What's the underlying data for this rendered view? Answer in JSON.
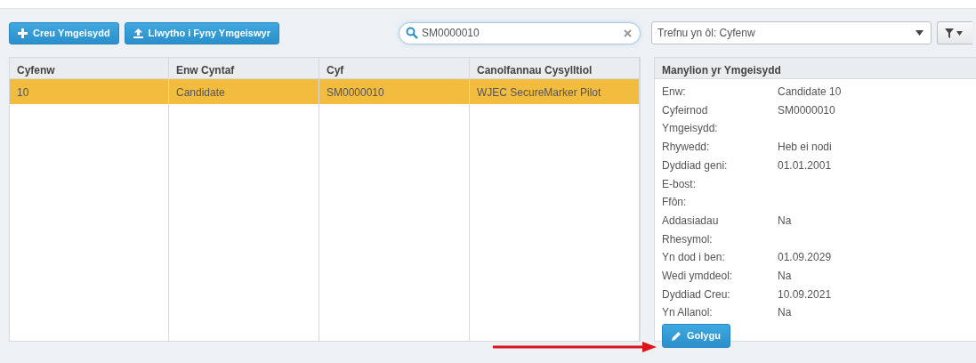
{
  "toolbar": {
    "buttons": [
      {
        "label": "Creu Ymgeisydd",
        "kind": "plus"
      },
      {
        "label": "Llwytho i Fyny Ymgeiswyr",
        "kind": "upload"
      }
    ]
  },
  "search": {
    "value": "SM0000010"
  },
  "sort": {
    "value": "Trefnu yn ôl: Cyfenw"
  },
  "table": {
    "columns": [
      "Cyfenw",
      "Enw Cyntaf",
      "Cyf",
      "Canolfannau Cysylltiol"
    ],
    "rows": [
      {
        "cells": [
          "10",
          "Candidate",
          "SM0000010",
          "WJEC SecureMarker Pilot"
        ],
        "selected": true
      }
    ]
  },
  "details": {
    "title": "Manylion yr Ymgeisydd",
    "fields": [
      {
        "label": "Enw:",
        "value": "Candidate 10"
      },
      {
        "label": "Cyfeirnod Ymgeisydd:",
        "value": "SM0000010"
      },
      {
        "label": "Rhywedd:",
        "value": "Heb ei nodi"
      },
      {
        "label": "Dyddiad geni:",
        "value": "01.01.2001"
      },
      {
        "label": "E-bost:"
      },
      {
        "label": "Ffôn:"
      },
      {
        "label": "Addasiadau Rhesymol:",
        "value": "Na"
      },
      {
        "label": "Yn dod i ben:",
        "value": "01.09.2029"
      },
      {
        "label": "Wedi ymddeol:",
        "value": "Na"
      },
      {
        "label": "Dyddiad Creu:",
        "value": "10.09.2021"
      },
      {
        "label": "Yn Allanol:",
        "value": "Na"
      }
    ],
    "edit_button": "Golygu"
  }
}
